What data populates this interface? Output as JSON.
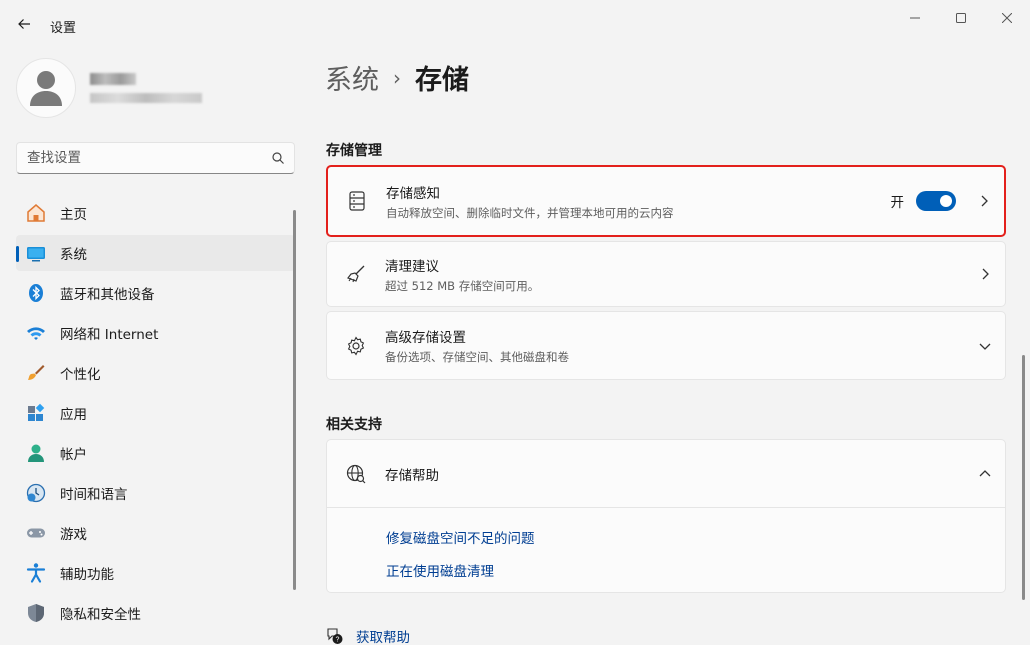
{
  "window": {
    "app_title": "设置"
  },
  "search": {
    "placeholder": "查找设置"
  },
  "sidebar": {
    "items": [
      {
        "label": "主页",
        "icon": "home-icon"
      },
      {
        "label": "系统",
        "icon": "system-icon",
        "active": true
      },
      {
        "label": "蓝牙和其他设备",
        "icon": "bluetooth-icon"
      },
      {
        "label": "网络和 Internet",
        "icon": "wifi-icon"
      },
      {
        "label": "个性化",
        "icon": "brush-icon"
      },
      {
        "label": "应用",
        "icon": "apps-icon"
      },
      {
        "label": "帐户",
        "icon": "account-icon"
      },
      {
        "label": "时间和语言",
        "icon": "clock-globe-icon"
      },
      {
        "label": "游戏",
        "icon": "gamepad-icon"
      },
      {
        "label": "辅助功能",
        "icon": "accessibility-icon"
      },
      {
        "label": "隐私和安全性",
        "icon": "shield-icon"
      }
    ]
  },
  "breadcrumb": {
    "parent": "系统",
    "separator": "›",
    "current": "存储"
  },
  "storage_management": {
    "title": "存储管理",
    "storage_sense": {
      "title": "存储感知",
      "desc": "自动释放空间、删除临时文件，并管理本地可用的云内容",
      "toggle_label": "开",
      "toggle_on": true
    },
    "cleanup": {
      "title": "清理建议",
      "desc": "超过 512 MB 存储空间可用。"
    },
    "advanced": {
      "title": "高级存储设置",
      "desc": "备份选项、存储空间、其他磁盘和卷"
    }
  },
  "related_support": {
    "title": "相关支持",
    "storage_help": {
      "title": "存储帮助",
      "links": [
        "修复磁盘空间不足的问题",
        "正在使用磁盘清理"
      ]
    }
  },
  "footer": {
    "get_help": "获取帮助"
  },
  "colors": {
    "accent": "#005fb8",
    "highlight_border": "#e3201b",
    "link": "#003e92"
  }
}
